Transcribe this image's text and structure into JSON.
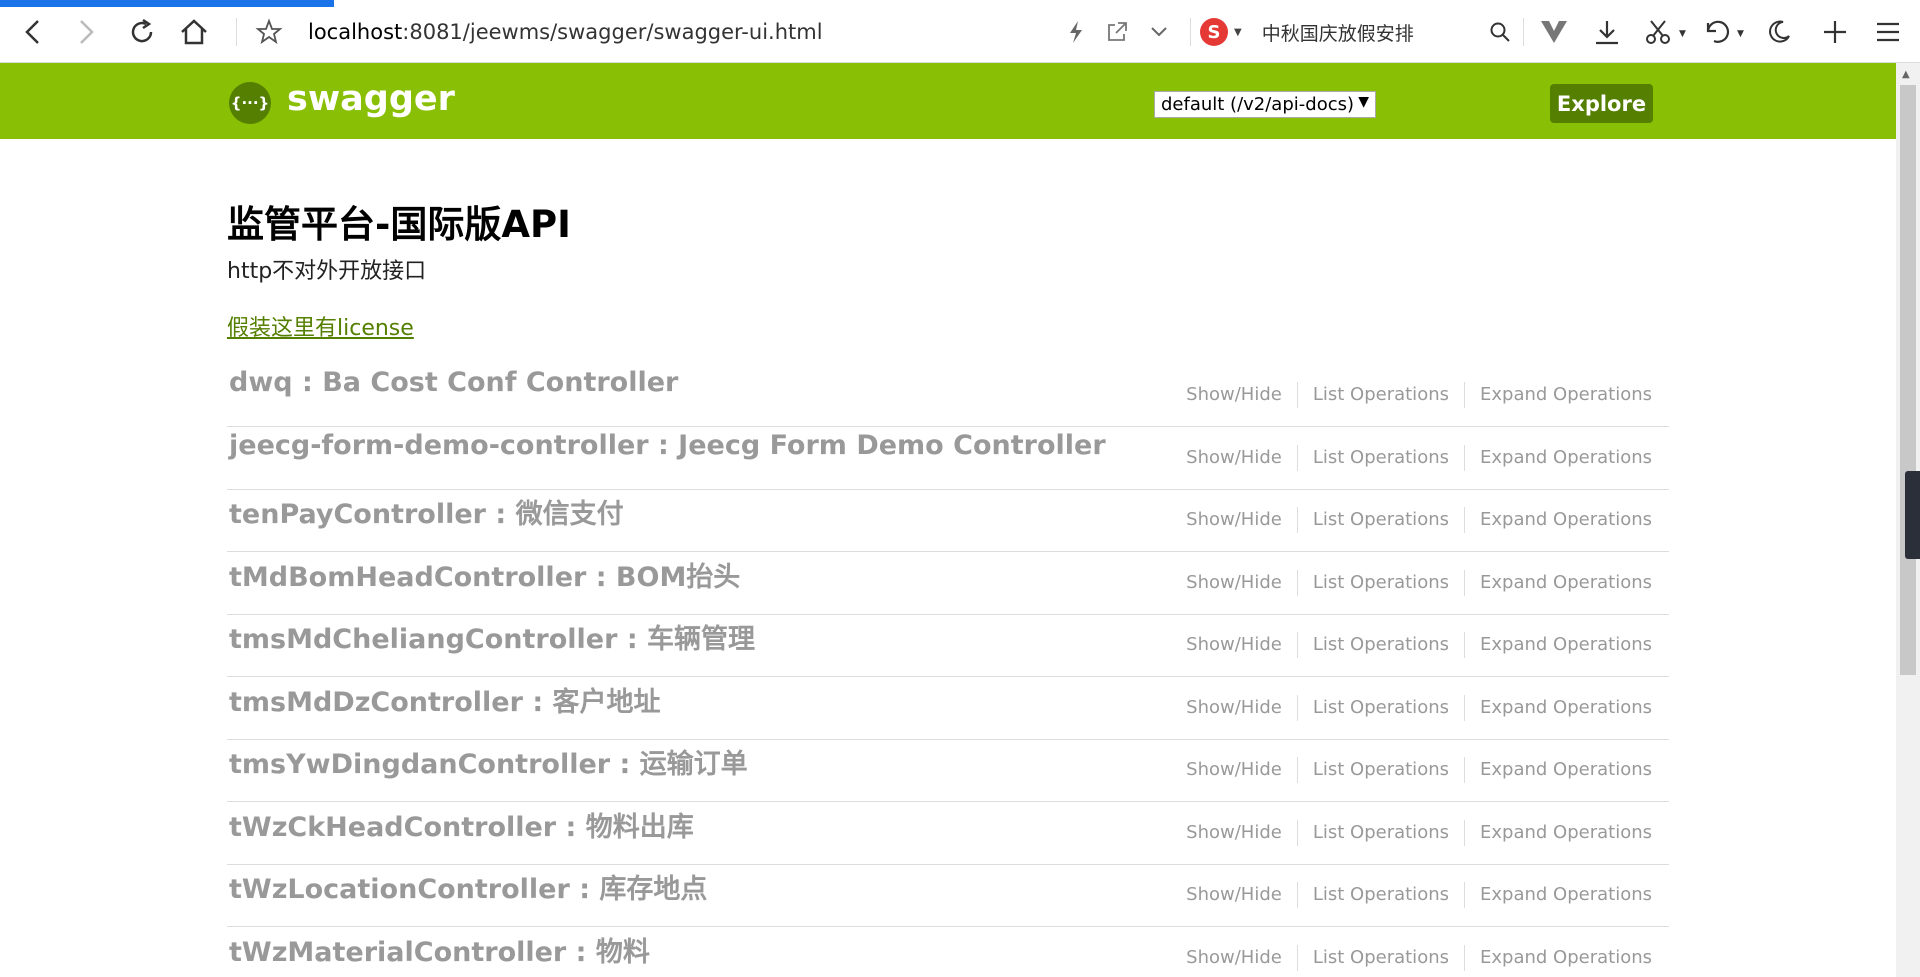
{
  "browser": {
    "url_host": "localhost",
    "url_rest": ":8081/jeewms/swagger/swagger-ui.html",
    "search_text": "中秋国庆放假安排",
    "search_logo": "S"
  },
  "swagger": {
    "brand": "swagger",
    "logo_glyph": "{···}",
    "spec_select": "default (/v2/api-docs)",
    "explore_label": "Explore"
  },
  "info": {
    "title": "监管平台-国际版API",
    "description": "http不对外开放接口",
    "license": "假装这里有license"
  },
  "op_labels": {
    "show_hide": "Show/Hide",
    "list": "List Operations",
    "expand": "Expand Operations"
  },
  "resources": [
    "dwq : Ba Cost Conf Controller",
    "jeecg-form-demo-controller : Jeecg Form Demo Controller",
    "tenPayController : 微信支付",
    "tMdBomHeadController : BOM抬头",
    "tmsMdCheliangController : 车辆管理",
    "tmsMdDzController : 客户地址",
    "tmsYwDingdanController : 运输订单",
    "tWzCkHeadController : 物料出库",
    "tWzLocationController : 库存地点",
    "tWzMaterialController : 物料"
  ],
  "icons": {
    "back": "back-icon",
    "forward": "forward-icon",
    "reload": "reload-icon",
    "home": "home-icon",
    "bookmark": "star-icon",
    "lightning": "lightning-icon",
    "share": "share-icon",
    "chevron": "chevron-down-icon",
    "search": "search-icon",
    "vpn": "v-icon",
    "download": "download-icon",
    "cut": "scissors-icon",
    "undo": "undo-icon",
    "night": "moon-icon",
    "newtab": "plus-icon",
    "menu": "menu-icon"
  },
  "colors": {
    "header_bg": "#89bf04",
    "accent_dark": "#547f00",
    "resource_text": "#999999",
    "progress": "#1a73e8"
  }
}
